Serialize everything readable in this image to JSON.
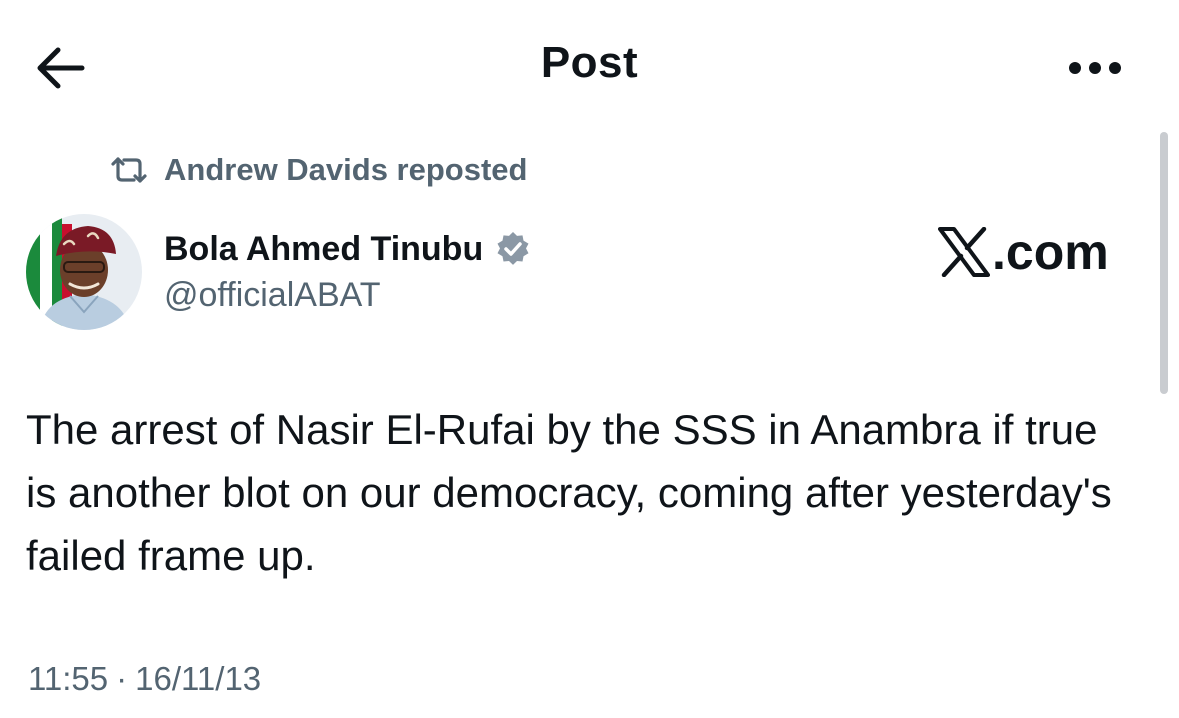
{
  "header": {
    "title": "Post",
    "back_icon": "arrow-left-icon",
    "more_icon": "more-horizontal-icon"
  },
  "repost": {
    "icon": "repost-icon",
    "label": "Andrew Davids reposted"
  },
  "author": {
    "name": "Bola Ahmed Tinubu",
    "handle": "@officialABAT",
    "verified_icon": "verified-badge-icon",
    "verified_color": "#8b98a5",
    "avatar": "profile-photo"
  },
  "watermark": {
    "text": ".com",
    "icon": "x-logo-icon"
  },
  "post": {
    "text": "The arrest of Nasir El-Rufai by the SSS in Anambra if true is another blot on our democracy, coming after yesterday's failed frame up.",
    "time": "11:55",
    "separator": "·",
    "date": "16/11/13"
  },
  "colors": {
    "text": "#0f1419",
    "secondary": "#536471",
    "background": "#ffffff"
  }
}
